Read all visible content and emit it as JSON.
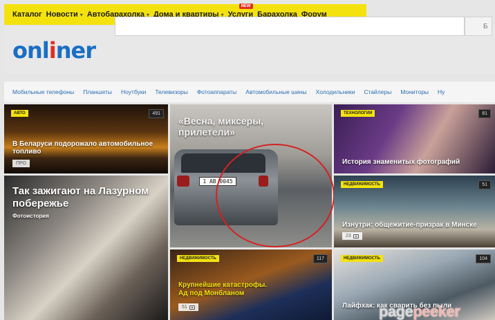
{
  "topnav": {
    "items": [
      {
        "label": "Каталог",
        "caret": ""
      },
      {
        "label": "Новости",
        "caret": "▾"
      },
      {
        "label": "Автобарахолка",
        "caret": "▾"
      },
      {
        "label": "Дома и квартиры",
        "caret": "▾"
      },
      {
        "label": "Услуги",
        "caret": "",
        "badge": "NEW"
      },
      {
        "label": "Барахолка",
        "caret": ""
      },
      {
        "label": "Форум",
        "caret": ""
      }
    ]
  },
  "header": {
    "logo_a": "onl",
    "logo_i": "i",
    "logo_b": "ner",
    "search_placeholder": "",
    "search_button": "Б"
  },
  "categories": [
    "Мобильные телефоны",
    "Планшеты",
    "Ноутбуки",
    "Телевизоры",
    "Фотоаппараты",
    "Автомобильные шины",
    "Холодильники",
    "Стайлеры",
    "Мониторы",
    "Ну"
  ],
  "tiles": {
    "t1": {
      "tag": "АВТО",
      "count": "491",
      "title": "В Беларуси подорожало автомобильное топливо",
      "chip": "ПРО"
    },
    "t2": {
      "title": "«Весна, миксеры, прилетели»",
      "plate": "1 АВ 0045"
    },
    "t3": {
      "tag": "ТЕХНОЛОГИИ",
      "count": "81",
      "title": "История знаменитых фотографий"
    },
    "t4": {
      "title": "Так зажигают на Лазурном побережье",
      "subtitle": "Фотоистория"
    },
    "t5": {
      "tag": "НЕДВИЖИМОСТЬ",
      "count": "51",
      "title": "Изнутри: общежитие-призрак в Минске",
      "chip": "23"
    },
    "t6": {
      "tag": "НЕДВИЖИМОСТЬ",
      "count": "117",
      "title": "Крупнейшие катастрофы. Ад под Монбланом",
      "chip": "51"
    },
    "t7": {
      "tag": "НЕДВИЖИМОСТЬ",
      "count": "104",
      "title": "Лайфхак: как сварить без пыли"
    }
  },
  "watermark": {
    "part1": "page",
    "part2": "peeker"
  }
}
